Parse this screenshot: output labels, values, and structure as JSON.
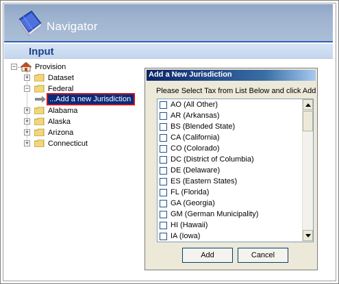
{
  "header": {
    "title": "Navigator"
  },
  "section": {
    "title": "Input"
  },
  "tree": {
    "root": "Provision",
    "items": [
      {
        "label": "Dataset"
      },
      {
        "label": "Federal"
      },
      {
        "label": "...Add a new Jurisdiction"
      },
      {
        "label": "Alabama"
      },
      {
        "label": "Alaska"
      },
      {
        "label": "Arizona"
      },
      {
        "label": "Connecticut"
      }
    ]
  },
  "dialog": {
    "title": "Add a New Jurisdiction",
    "instructions": "Please Select Tax from List Below and click Add",
    "list": [
      "AO (All Other)",
      "AR (Arkansas)",
      "BS (Blended State)",
      "CA (California)",
      "CO (Colorado)",
      "DC (District of Columbia)",
      "DE (Delaware)",
      "ES (Eastern States)",
      "FL (Florida)",
      "GA (Georgia)",
      "GM (German Municipality)",
      "HI (Hawaii)",
      "IA (Iowa)"
    ],
    "add_label": "Add",
    "cancel_label": "Cancel"
  },
  "colors": {
    "header_bg": "#9fb4cf",
    "accent_blue": "#2c5fb3",
    "selected_bg": "#0a2a7a",
    "selected_border": "#c8141e",
    "dialog_title": "#0a246a"
  }
}
